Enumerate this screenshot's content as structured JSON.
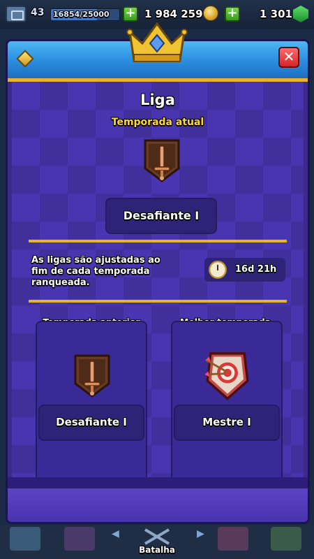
{
  "status_bar": {
    "level": "43",
    "xp_progress": "16854/25000",
    "xp_fraction": 0.674,
    "gold": "1 984 259",
    "gems": "1 301",
    "add_gold_label": "+",
    "add_gems_label": "+"
  },
  "modal": {
    "close_label": "✕",
    "title": "Liga",
    "current_season": {
      "label": "Temporada atual",
      "league": "Desafiante I"
    },
    "info_text": "As ligas são ajustadas ao fim de cada temporada ranqueada.",
    "timer": "16d 21h",
    "previous_season": {
      "label": "Temporada anterior",
      "league": "Desafiante I"
    },
    "best_season": {
      "label": "Melhor temporada",
      "league": "Mestre I"
    }
  },
  "bottom_nav": {
    "active_tab": "Batalha"
  },
  "colors": {
    "modal_purple": "#4a35b0",
    "header_blue": "#2c8fe0",
    "gold_accent": "#e3b52d",
    "subtitle_yellow": "#ffd83a",
    "close_red": "#d4252a"
  },
  "icons": [
    "crown-icon",
    "diamond-icon",
    "close-icon",
    "bronze-sword-shield-icon",
    "clock-icon",
    "master-target-shield-icon",
    "gold-coin-icon",
    "gem-icon",
    "xp-icon"
  ]
}
